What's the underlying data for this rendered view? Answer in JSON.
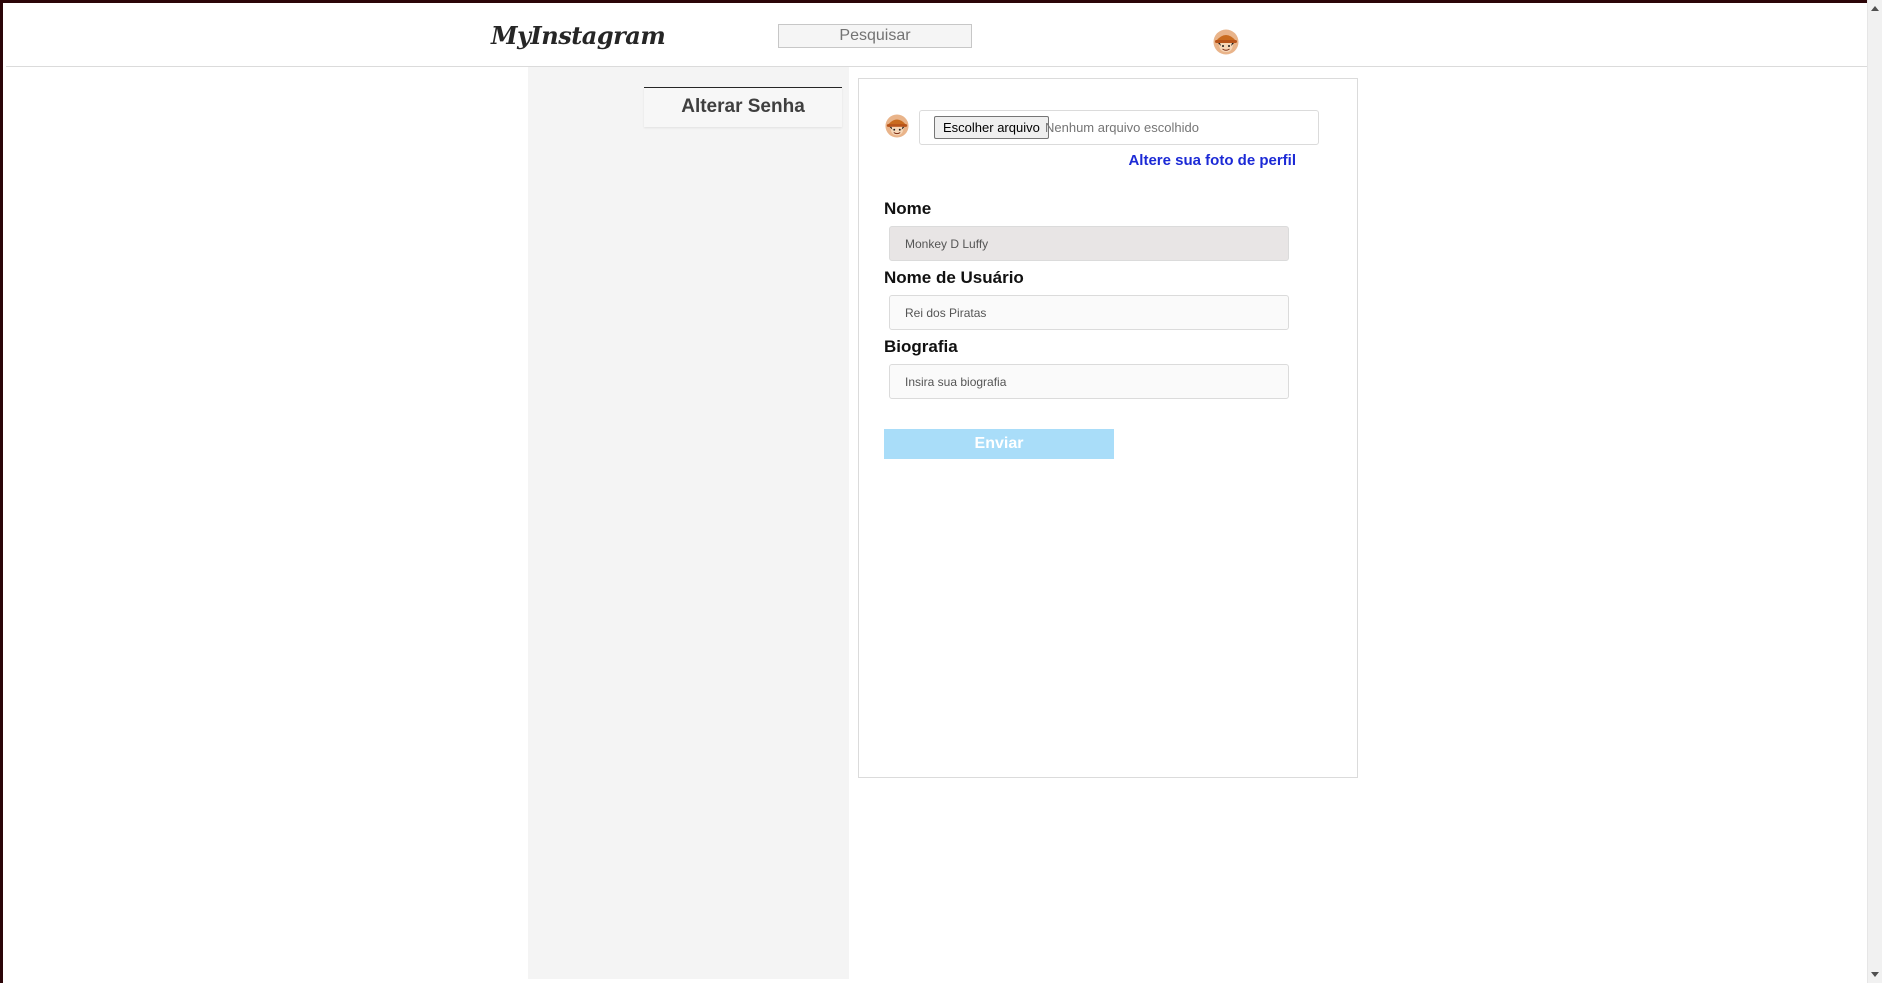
{
  "header": {
    "logo": "MyInstagram",
    "search_placeholder": "Pesquisar"
  },
  "sidebar": {
    "items": [
      {
        "label": "Alterar Senha"
      }
    ]
  },
  "profile_form": {
    "file_button_label": "Escolher arquivo",
    "file_status": "Nenhum arquivo escolhido",
    "change_photo_link": "Altere sua foto de perfil",
    "fields": [
      {
        "label": "Nome",
        "placeholder": "Monkey D Luffy",
        "disabled": true
      },
      {
        "label": "Nome de Usuário",
        "placeholder": "Rei dos Piratas",
        "disabled": false
      },
      {
        "label": "Biografia",
        "placeholder": "Insira sua biografia",
        "disabled": false
      }
    ],
    "submit_label": "Enviar"
  },
  "colors": {
    "link": "#1c2ad6",
    "submit_bg": "#a9ddf9",
    "sidebar_bg": "#f4f4f4",
    "border": "#dbdbdb"
  },
  "icons": {
    "avatar": "straw-hat-avatar-icon"
  }
}
